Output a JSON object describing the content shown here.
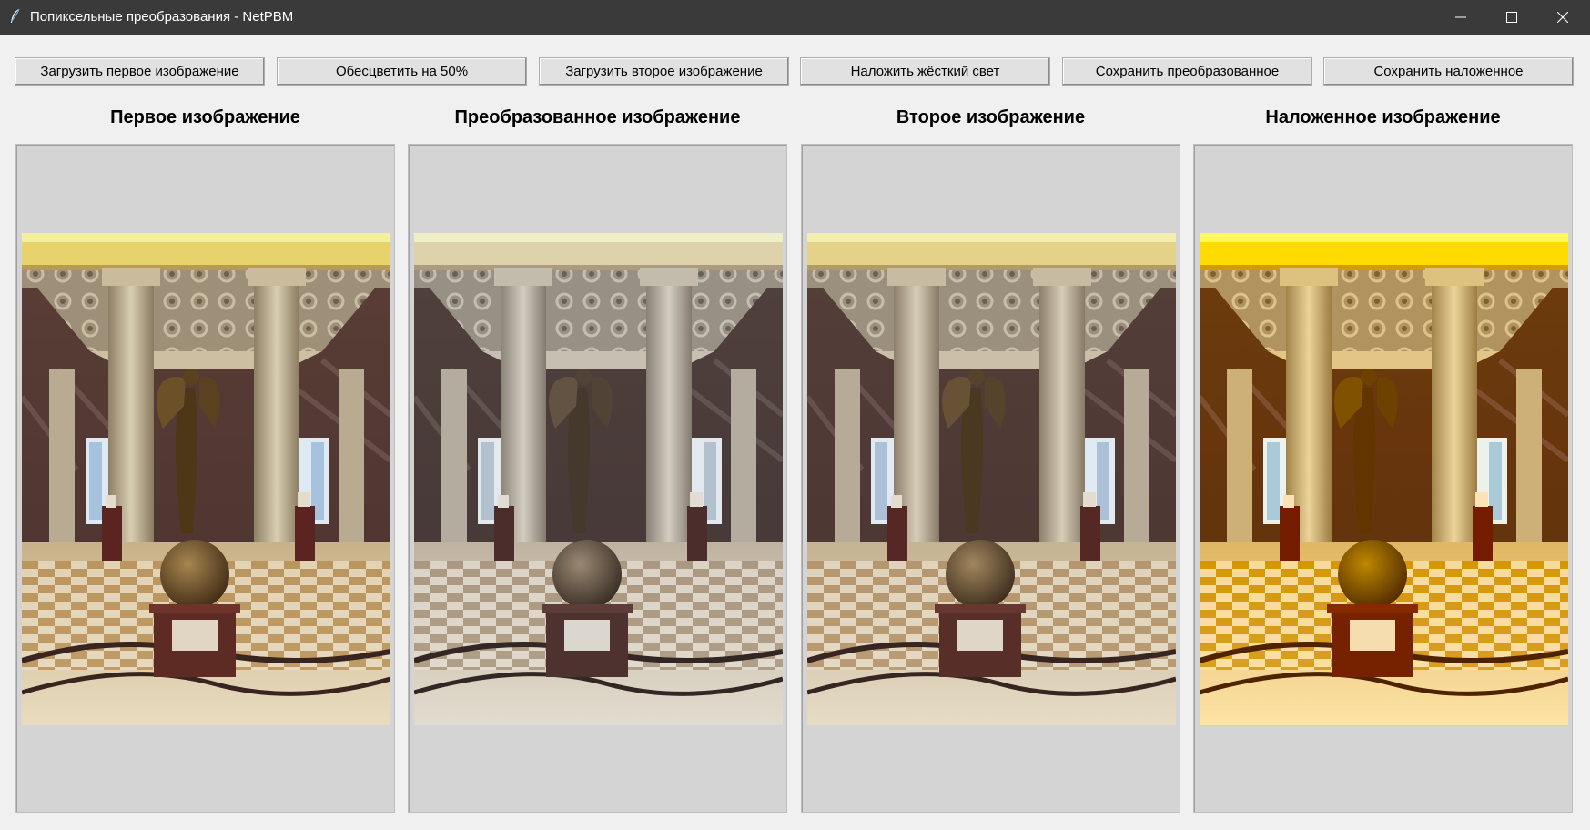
{
  "window": {
    "title": "Попиксельные преобразования - NetPBM",
    "icon": "feather-icon",
    "controls": [
      "minimize-icon",
      "maximize-icon",
      "close-icon"
    ]
  },
  "toolbar": {
    "load_first_label": "Загрузить первое изображение",
    "desaturate_label": "Обесцветить на 50%",
    "load_second_label": "Загрузить второе изображение",
    "hard_light_label": "Наложить жёсткий свет",
    "save_transformed_label": "Сохранить преобразованное",
    "save_overlay_label": "Сохранить наложенное"
  },
  "panels": {
    "first_title": "Первое изображение",
    "transformed_title": "Преобразованное изображение",
    "second_title": "Второе изображение",
    "overlay_title": "Наложенное изображение"
  },
  "colors": {
    "titlebar": "#3a3a3a",
    "window_bg": "#f0f0f0",
    "panel_bg": "#d4d4d4",
    "button_bg": "#e1e1e1"
  }
}
